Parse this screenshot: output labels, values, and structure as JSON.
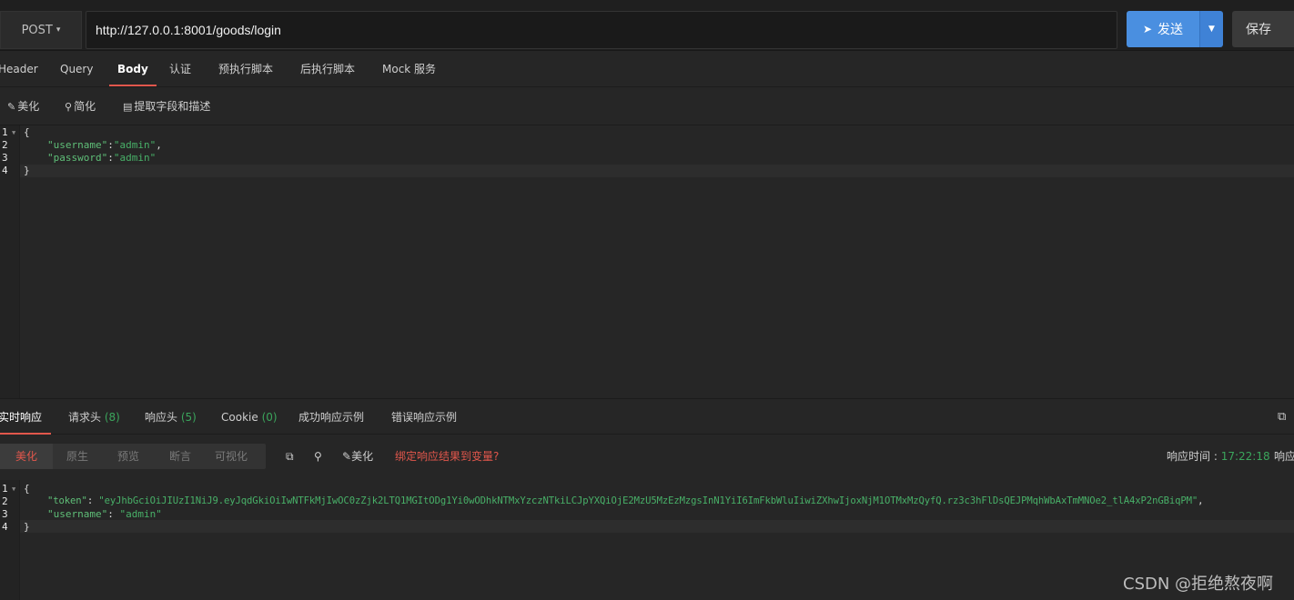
{
  "request": {
    "method": "POST",
    "url": "http://127.0.0.1:8001/goods/login",
    "send_label": "发送",
    "save_label": "保存"
  },
  "req_tabs": [
    {
      "label": "Header"
    },
    {
      "label": "Query"
    },
    {
      "label": "Body"
    },
    {
      "label": "认证"
    },
    {
      "label": "预执行脚本"
    },
    {
      "label": "后执行脚本"
    },
    {
      "label": "Mock 服务"
    }
  ],
  "body_toolbar": {
    "beautify": "美化",
    "simplify": "简化",
    "extract": "提取字段和描述"
  },
  "request_body": {
    "line_numbers": [
      "1",
      "2",
      "3",
      "4"
    ],
    "open": "{",
    "close": "}",
    "fields": [
      {
        "key": "\"username\"",
        "value": "\"admin\""
      },
      {
        "key": "\"password\"",
        "value": "\"admin\""
      }
    ]
  },
  "resp_tabs": [
    {
      "label": "实时响应",
      "count": ""
    },
    {
      "label": "请求头",
      "count": "(8)"
    },
    {
      "label": "响应头",
      "count": "(5)"
    },
    {
      "label": "Cookie",
      "count": "(0)"
    },
    {
      "label": "成功响应示例",
      "count": ""
    },
    {
      "label": "错误响应示例",
      "count": ""
    }
  ],
  "resp_toolbar": {
    "segments": [
      "美化",
      "原生",
      "预览",
      "断言",
      "可视化"
    ],
    "beautify": "美化",
    "bind_label": "绑定响应结果到变量?",
    "time_label": "响应时间 : ",
    "time_value": "17:22:18",
    "size_label": "响应"
  },
  "response_body": {
    "line_numbers": [
      "1",
      "2",
      "3",
      "4"
    ],
    "open": "{",
    "close": "}",
    "fields": [
      {
        "key": "\"token\"",
        "value": "\"eyJhbGciOiJIUzI1NiJ9.eyJqdGkiOiIwNTFkMjIwOC0zZjk2LTQ1MGItODg1Yi0wODhkNTMxYzczNTkiLCJpYXQiOjE2MzU5MzEzMzgsInN1YiI6ImFkbWluIiwiZXhwIjoxNjM1OTMxMzQyfQ.rz3c3hFlDsQEJPMqhWbAxTmMNOe2_tlA4xP2nGBiqPM\""
      },
      {
        "key": "\"username\"",
        "value": "\"admin\""
      }
    ]
  },
  "watermark": "CSDN @拒绝熬夜啊"
}
